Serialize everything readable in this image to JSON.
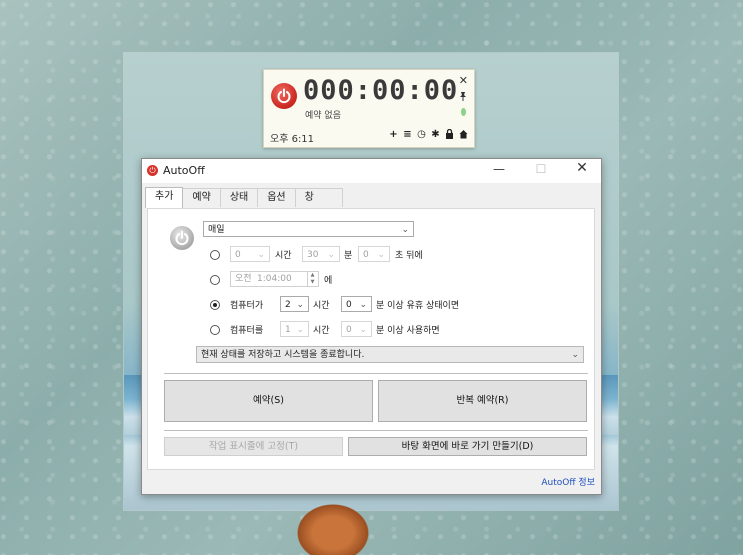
{
  "widget": {
    "timer": "000:00:00",
    "status": "예약 없음",
    "clock": "오후 6:11",
    "close_glyph": "✕",
    "pin_glyph": "📌",
    "tools": [
      "plus-icon",
      "list-icon",
      "clock-icon",
      "gear-icon",
      "lock-icon",
      "home-icon"
    ],
    "tool_glyphs": [
      "+",
      "≡",
      "◷",
      "✱",
      "🔒",
      "⌂"
    ]
  },
  "window": {
    "title": "AutoOff",
    "minimize": "—",
    "maximize": "☐",
    "close": "✕",
    "tabs": [
      "추가",
      "예약",
      "상태",
      "옵션",
      "창"
    ],
    "active_tab": 0
  },
  "form": {
    "repeat": "매일",
    "row1": {
      "hours": "0",
      "hours_label": "시간",
      "minutes": "30",
      "minutes_label": "분",
      "seconds": "0",
      "seconds_label": "초 뒤에"
    },
    "row2": {
      "ampm": "오전",
      "time": "1:04:00",
      "suffix": "에"
    },
    "row3": {
      "prefix": "컴퓨터가",
      "hours": "2",
      "hours_label": "시간",
      "minutes": "0",
      "suffix": "분 이상 유휴 상태이면"
    },
    "row4": {
      "prefix": "컴퓨터를",
      "hours": "1",
      "hours_label": "시간",
      "minutes": "0",
      "suffix": "분 이상 사용하면"
    },
    "selected_option": 3,
    "action": "현재 상태를 저장하고 시스템을 종료합니다."
  },
  "buttons": {
    "reserve": "예약(S)",
    "repeat_reserve": "반복 예약(R)",
    "pin_taskbar": "작업 표시줄에 고정(T)",
    "desktop_shortcut": "바탕 화면에 바로 가기 만들기(D)"
  },
  "footer": {
    "about": "AutoOff 정보"
  },
  "colors": {
    "accent_red": "#c9261e",
    "link_blue": "#1f4fbf"
  }
}
